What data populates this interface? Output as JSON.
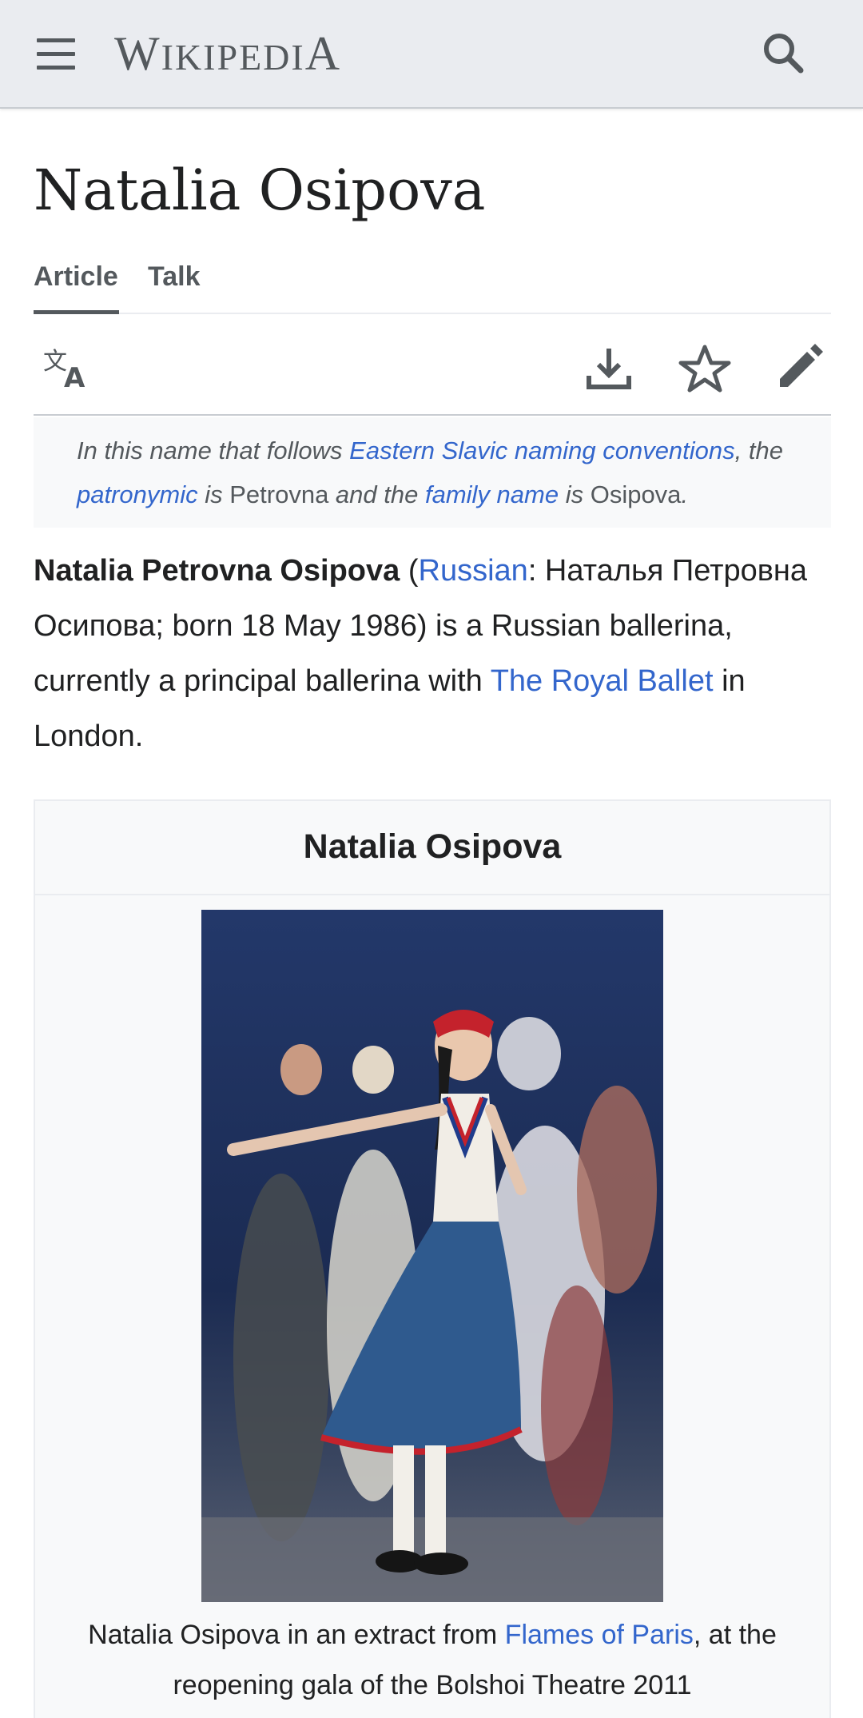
{
  "header": {
    "menu_icon": "menu-icon",
    "wordmark_first": "W",
    "wordmark_small": "IKIPEDI",
    "wordmark_last": "A",
    "search_icon": "search-icon"
  },
  "page": {
    "title": "Natalia Osipova"
  },
  "tabs": [
    {
      "label": "Article",
      "active": true
    },
    {
      "label": "Talk",
      "active": false
    }
  ],
  "actions": {
    "language_icon": "language-icon",
    "download_icon": "download-icon",
    "watch_icon": "star-icon",
    "edit_icon": "edit-icon"
  },
  "hatnote": {
    "t1": "In this name that follows ",
    "link1": "Eastern Slavic naming conventions",
    "t2": ", the ",
    "link2": "patronymic",
    "t3": " is ",
    "v1": "Petrovna",
    "t4": " and the ",
    "link3": "family name",
    "t5": " is ",
    "v2": "Osipova",
    "t6": "."
  },
  "lead": {
    "bold_name": "Natalia Petrovna Osipova",
    "t1": " (",
    "link_russian": "Russian",
    "t2": ": Наталья Петровна Осипова; born 18 May 1986) is a Russian ballerina, currently a principal ballerina with ",
    "link_ballet": "The Royal Ballet",
    "t3": " in London."
  },
  "infobox": {
    "title": "Natalia Osipova",
    "caption_t1": "Natalia Osipova in an extract from ",
    "caption_link": "Flames of Paris",
    "caption_t2": ", at the reopening gala of the Bolshoi Theatre 2011"
  },
  "colors": {
    "header_bg": "#eaecf0",
    "link": "#3366cc",
    "text": "#202122",
    "muted": "#54595d",
    "hatnote_bg": "#f8f9fa"
  }
}
